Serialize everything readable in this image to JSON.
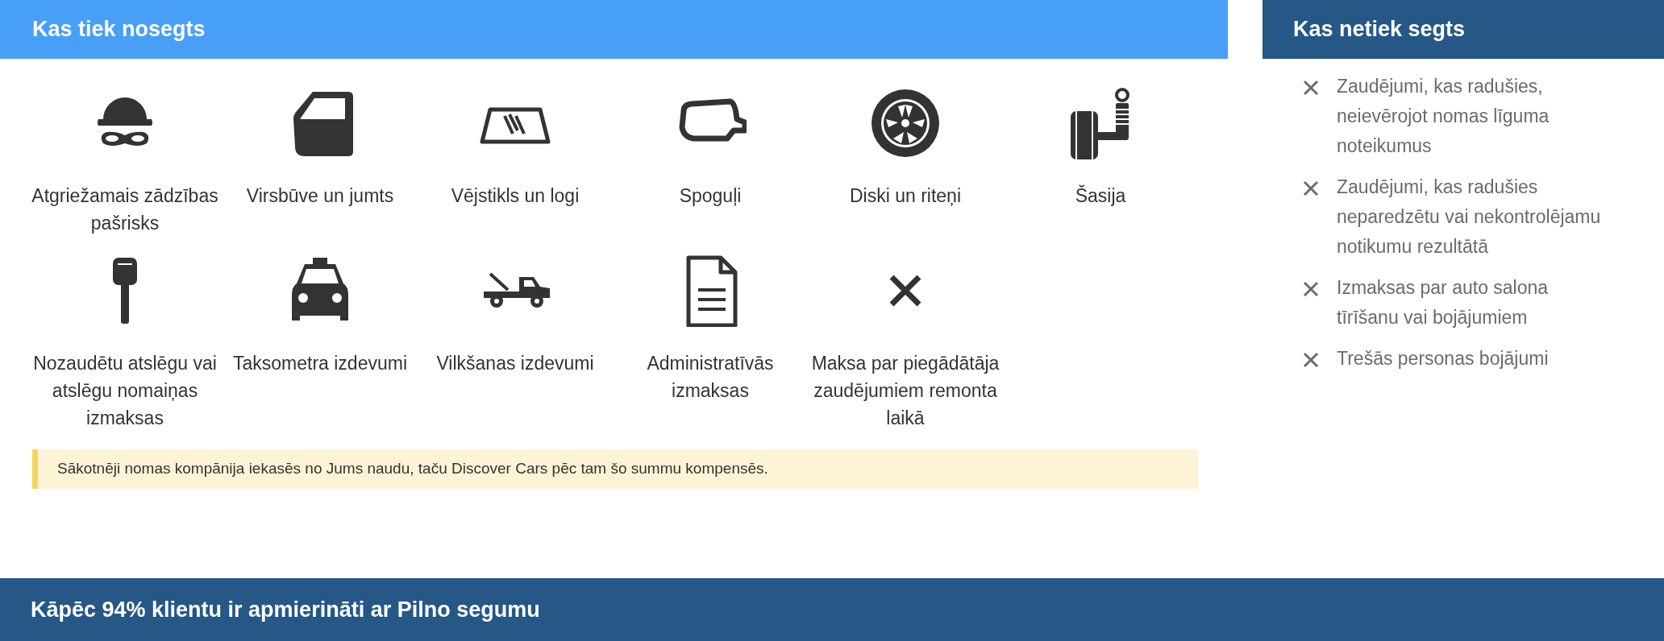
{
  "covered": {
    "title": "Kas tiek nosegts",
    "items": [
      {
        "kind": "thief",
        "label": "Atgriežamais zādzības pašrisks"
      },
      {
        "kind": "door",
        "label": "Virsbūve un jumts"
      },
      {
        "kind": "windshield",
        "label": "Vējstikls un logi"
      },
      {
        "kind": "mirror",
        "label": "Spoguļi"
      },
      {
        "kind": "wheel",
        "label": "Diski un riteņi"
      },
      {
        "kind": "suspension",
        "label": "Šasija"
      },
      {
        "kind": "key",
        "label": "Nozaudētu atslēgu vai atslēgu nomaiņas izmaksas"
      },
      {
        "kind": "taxi",
        "label": "Taksometra izdevumi"
      },
      {
        "kind": "towtruck",
        "label": "Vilkšanas izdevumi"
      },
      {
        "kind": "document",
        "label": "Administratīvās izmaksas"
      },
      {
        "kind": "cross",
        "label": "Maksa par piegādātāja zaudējumiem remonta laikā"
      }
    ],
    "note": "Sākotnēji nomas kompānija iekasēs no Jums naudu, taču Discover Cars pēc tam šo summu kompensēs."
  },
  "not_covered": {
    "title": "Kas netiek segts",
    "items": [
      "Zaudējumi, kas radušies, neievērojot nomas līguma noteikumus",
      "Zaudējumi, kas radušies neparedzētu vai nekontrolējamu notikumu rezultātā",
      "Izmaksas par auto salona tīrīšanu vai bojājumiem",
      "Trešās personas bojājumi"
    ]
  },
  "satisfaction": {
    "title": "Kāpēc 94% klientu ir apmierināti ar Pilno segumu"
  }
}
